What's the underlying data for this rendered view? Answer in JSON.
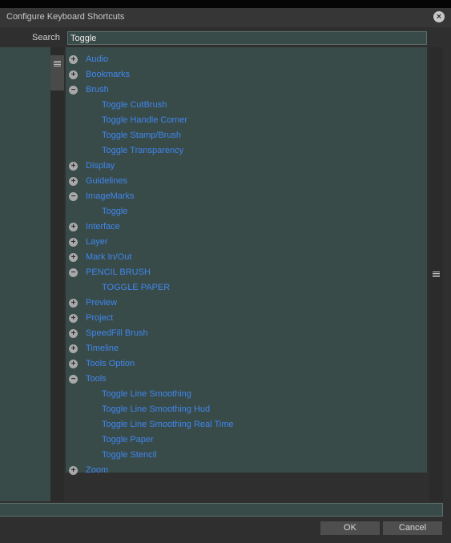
{
  "window": {
    "title": "Configure Keyboard Shortcuts",
    "close_glyph": "×"
  },
  "search": {
    "label": "Search",
    "value": "Toggle"
  },
  "tree": [
    {
      "type": "category",
      "label": "Audio",
      "expanded": false
    },
    {
      "type": "category",
      "label": "Bookmarks",
      "expanded": false
    },
    {
      "type": "category",
      "label": "Brush",
      "expanded": true
    },
    {
      "type": "item",
      "label": "Toggle CutBrush"
    },
    {
      "type": "item",
      "label": "Toggle Handle Corner"
    },
    {
      "type": "item",
      "label": "Toggle Stamp/Brush"
    },
    {
      "type": "item",
      "label": "Toggle Transparency"
    },
    {
      "type": "category",
      "label": "Display",
      "expanded": false
    },
    {
      "type": "category",
      "label": "Guidelines",
      "expanded": false
    },
    {
      "type": "category",
      "label": "ImageMarks",
      "expanded": true
    },
    {
      "type": "item",
      "label": "Toggle"
    },
    {
      "type": "category",
      "label": "Interface",
      "expanded": false
    },
    {
      "type": "category",
      "label": "Layer",
      "expanded": false
    },
    {
      "type": "category",
      "label": "Mark In/Out",
      "expanded": false
    },
    {
      "type": "category",
      "label": "PENCIL BRUSH",
      "expanded": true
    },
    {
      "type": "item",
      "label": "TOGGLE PAPER"
    },
    {
      "type": "category",
      "label": "Preview",
      "expanded": false
    },
    {
      "type": "category",
      "label": "Project",
      "expanded": false
    },
    {
      "type": "category",
      "label": "SpeedFill Brush",
      "expanded": false
    },
    {
      "type": "category",
      "label": "Timeline",
      "expanded": false
    },
    {
      "type": "category",
      "label": "Tools Option",
      "expanded": false
    },
    {
      "type": "category",
      "label": "Tools",
      "expanded": true
    },
    {
      "type": "item",
      "label": "Toggle Line Smoothing"
    },
    {
      "type": "item",
      "label": "Toggle Line Smoothing Hud"
    },
    {
      "type": "item",
      "label": "Toggle Line Smoothing Real Time"
    },
    {
      "type": "item",
      "label": "Toggle Paper"
    },
    {
      "type": "item",
      "label": "Toggle Stencil"
    },
    {
      "type": "category",
      "label": "Zoom",
      "expanded": false
    }
  ],
  "buttons": {
    "ok": "OK",
    "cancel": "Cancel"
  },
  "icons": {
    "expand": "plus-circle-icon",
    "collapse": "minus-circle-icon",
    "grip": "grip-lines-icon"
  },
  "colors": {
    "panel_bg": "#394b48",
    "link_blue": "#3f86f0"
  }
}
